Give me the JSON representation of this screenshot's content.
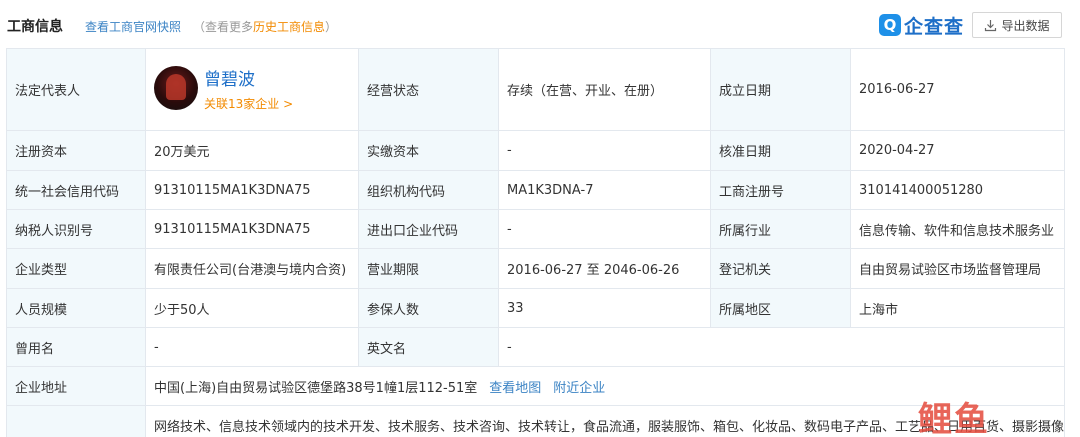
{
  "header": {
    "title": "工商信息",
    "official_link": "查看工商官网快照",
    "more_prefix": "（查看更多",
    "more_highlight": "历史工商信息",
    "more_suffix": "）",
    "logo_mark": "Q",
    "logo_text": "企查查",
    "export_label": "导出数据"
  },
  "representative": {
    "label": "法定代表人",
    "name": "曾碧波",
    "associated": "关联13家企业 >"
  },
  "rows": {
    "status_label": "经营状态",
    "status_value": "存续（在营、开业、在册）",
    "founded_label": "成立日期",
    "founded_value": "2016-06-27",
    "capital_label": "注册资本",
    "capital_value": "20万美元",
    "paidin_label": "实缴资本",
    "paidin_value": "-",
    "approve_label": "核准日期",
    "approve_value": "2020-04-27",
    "credit_label": "统一社会信用代码",
    "credit_value": "91310115MA1K3DNA75",
    "orgcode_label": "组织机构代码",
    "orgcode_value": "MA1K3DNA-7",
    "regno_label": "工商注册号",
    "regno_value": "310141400051280",
    "taxid_label": "纳税人识别号",
    "taxid_value": "91310115MA1K3DNA75",
    "impexp_label": "进出口企业代码",
    "impexp_value": "-",
    "industry_label": "所属行业",
    "industry_value": "信息传输、软件和信息技术服务业",
    "type_label": "企业类型",
    "type_value": "有限责任公司(台港澳与境内合资)",
    "term_label": "营业期限",
    "term_value": "2016-06-27 至 2046-06-26",
    "authority_label": "登记机关",
    "authority_value": "自由贸易试验区市场监督管理局",
    "staff_label": "人员规模",
    "staff_value": "少于50人",
    "insured_label": "参保人数",
    "insured_value": "33",
    "region_label": "所属地区",
    "region_value": "上海市",
    "formername_label": "曾用名",
    "formername_value": "-",
    "english_label": "英文名",
    "english_value": "-",
    "address_label": "企业地址",
    "address_value": "中国(上海)自由贸易试验区德堡路38号1幢1层112-51室",
    "address_map_link": "查看地图",
    "address_nearby_link": "附近企业",
    "scope_value": "网络技术、信息技术领域内的技术开发、技术服务、技术咨询、技术转让，食品流通，服装服饰、箱包、化妆品、数码电子产品、工艺品、日用百货、摄影摄像器"
  },
  "watermark": "鲤鱼"
}
